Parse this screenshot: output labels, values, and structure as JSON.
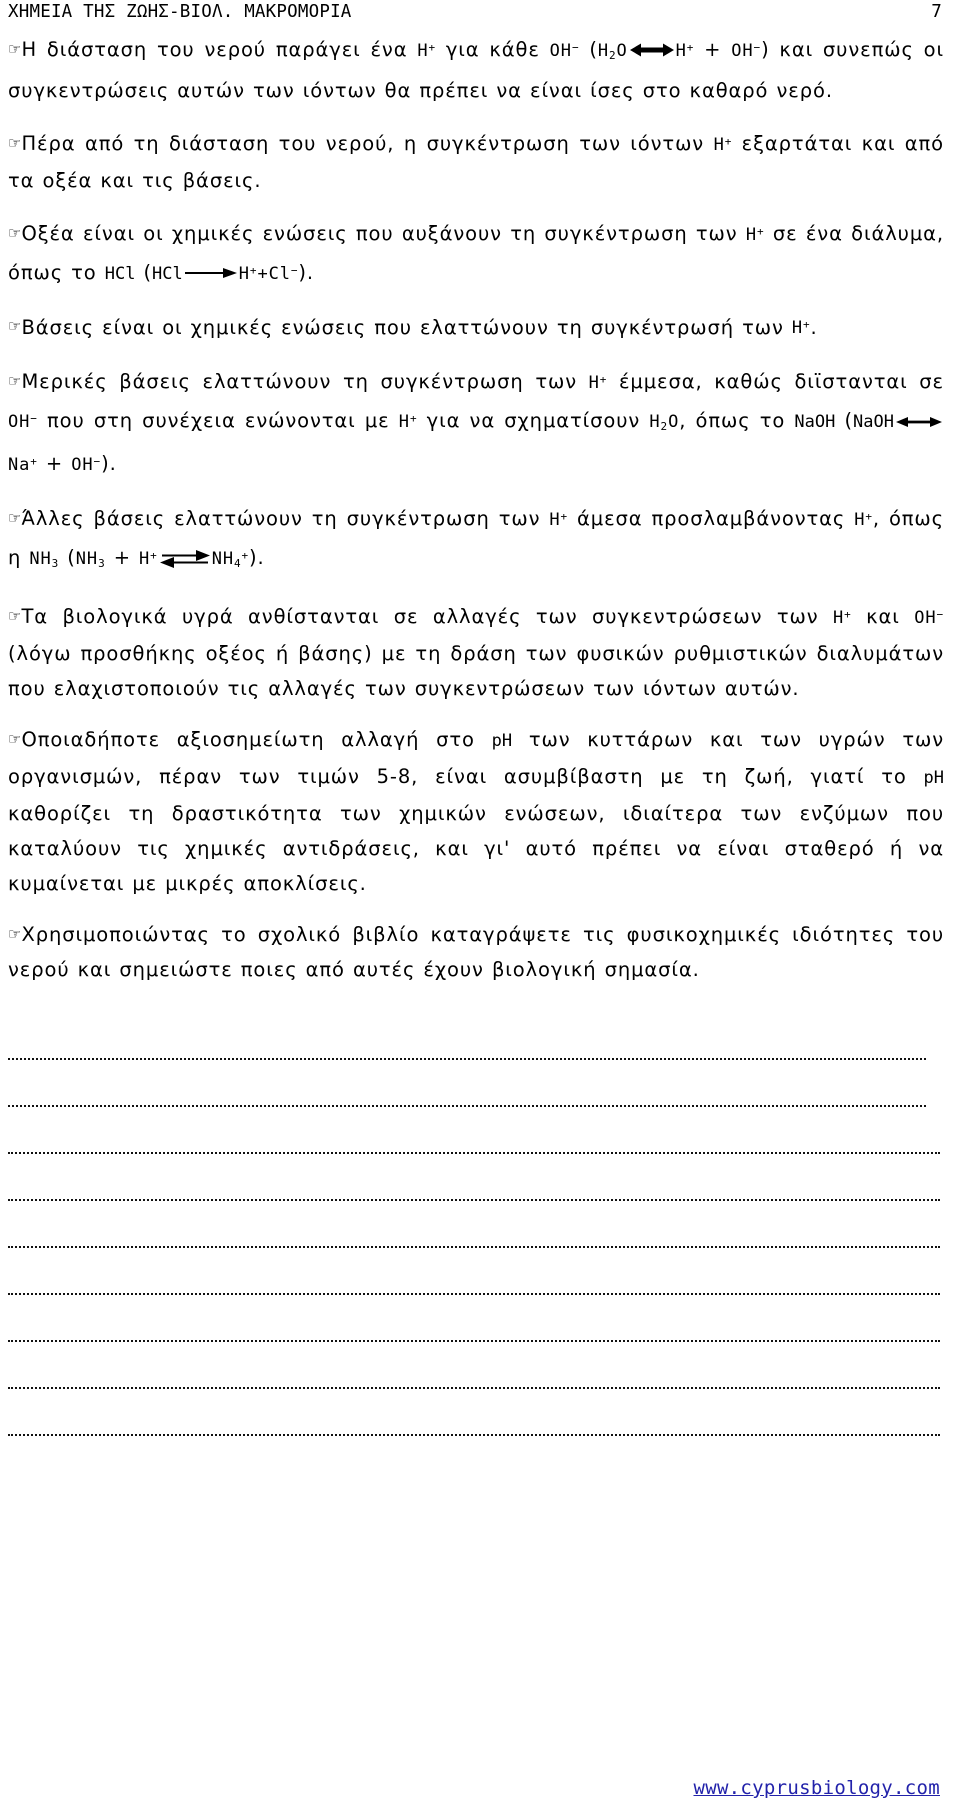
{
  "header": {
    "title": "ΧΗΜΕΙΑ ΤΗΣ ΖΩΗΣ-ΒΙΟΛ. ΜΑΚΡΟΜΟΡΙΑ",
    "page_number": "7"
  },
  "bullet_glyph": "☞",
  "paragraphs": [
    {
      "id": "p1-water-dissociation",
      "bullet": "☞",
      "parts": [
        {
          "type": "text",
          "value": "Η διάσταση του νερού παράγει ένα "
        },
        {
          "type": "chem",
          "value": "H+"
        },
        {
          "type": "text",
          "value": " για κάθε "
        },
        {
          "type": "chem",
          "value": "OH−"
        },
        {
          "type": "text",
          "value": " ("
        },
        {
          "type": "chem",
          "value": "H2O"
        },
        {
          "type": "arrow",
          "value": "double-head-bold"
        },
        {
          "type": "chem",
          "value": "H+"
        },
        {
          "type": "text",
          "value": " + "
        },
        {
          "type": "chem",
          "value": "OH−"
        },
        {
          "type": "text",
          "value": ") και συνεπώς οι συγκεντρώσεις αυτών των ιόντων θα πρέπει να είναι ίσες στο καθαρό νερό."
        }
      ],
      "plain_text": "Η διάσταση του νερού παράγει ένα H+ για κάθε OH− (H2O ⟺ H+ + OH−) και συνεπώς οι συγκεντρώσεις αυτών των ιόντων θα πρέπει να είναι ίσες στο καθαρό νερό."
    },
    {
      "id": "p2-beyond-dissociation",
      "bullet": "☞",
      "plain_text": "Πέρα από τη διάσταση του νερού, η συγκέντρωση των ιόντων H+ εξαρτάται και από τα οξέα και τις βάσεις."
    },
    {
      "id": "p3-acids",
      "bullet": "☞",
      "plain_text": "Οξέα είναι οι χημικές ενώσεις που αυξάνουν τη συγκέντρωση των H+ σε ένα διάλυμα, όπως το HCl (HCl ⟶ H++Cl−)."
    },
    {
      "id": "p4-bases",
      "bullet": "☞",
      "plain_text": "Βάσεις είναι οι χημικές ενώσεις που ελαττώνουν τη συγκέντρωσή των H+."
    },
    {
      "id": "p5-some-bases",
      "bullet": "☞",
      "plain_text": "Μερικές βάσεις ελαττώνουν τη συγκέντρωση των H+ έμμεσα, καθώς διϊστανται σε OH− που στη συνέχεια ενώνονται με H+ για να σχηματίσουν H2O, όπως το NaOH (NaOH ↔ Na+ + OH−)."
    },
    {
      "id": "p6-other-bases",
      "bullet": "☞",
      "plain_text": "Άλλες βάσεις ελαττώνουν τη συγκέντρωση των H+ άμεσα προσλαμβάνοντας H+, όπως η NH3 (NH3 + H+ ⇌ NH4+)."
    },
    {
      "id": "p7-biological-fluids",
      "bullet": "☞",
      "plain_text": "Τα βιολογικά υγρά ανθίστανται σε αλλαγές των συγκεντρώσεων των H+ και OH− (λόγω προσθήκης οξέος ή βάσης) με τη δράση των φυσικών ρυθμιστικών διαλυμάτων που ελαχιστοποιούν τις αλλαγές των συγκεντρώσεων των ιόντων αυτών."
    },
    {
      "id": "p8-ph-range",
      "bullet": "☞",
      "plain_text": "Οποιαδήποτε αξιοσημείωτη αλλαγή στο pH των κυττάρων και των υγρών των οργανισμών, πέραν των τιμών 5-8, είναι ασυμβίβαστη με τη ζωή, γιατί το pH καθορίζει τη δραστικότητα των χημικών ενώσεων, ιδιαίτερα των ενζύμων που καταλύουν τις χημικές αντιδράσεις, και γι' αυτό πρέπει να είναι σταθερό ή να κυμαίνεται με μικρές αποκλίσεις."
    },
    {
      "id": "p9-task",
      "bullet": "☞",
      "plain_text": "Χρησιμοποιώντας το σχολικό βιβλίο καταγράψετε τις φυσικοχημικές ιδιότητες του νερού και σημειώστε ποιες από αυτές έχουν βιολογική σημασία."
    }
  ],
  "paragraph_lines": {
    "p1": [
      "Η διάσταση του νερού παράγει ένα H+ για κάθε OH− (H2O ⟺ H+ +",
      "OH−) και συνεπώς οι συγκεντρώσεις αυτών των ιόντων θα πρέπει να",
      "είναι ίσες στο καθαρό νερό."
    ],
    "p2": [
      "Πέρα από τη διάσταση του νερού, η συγκέντρωση των ιόντων H+",
      "εξαρτάται και από τα οξέα και τις βάσεις."
    ],
    "p3": [
      "Οξέα είναι οι χημικές ενώσεις που αυξάνουν τη συγκέντρωση των",
      "H+ σε ένα διάλυμα, όπως το HCl (HCl ⟶ H++Cl−)."
    ],
    "p4": [
      "Βάσεις είναι οι χημικές ενώσεις που ελαττώνουν τη συγκέντρωσή",
      "των H+."
    ],
    "p5": [
      "Μερικές βάσεις ελαττώνουν τη συγκέντρωση των H+ έμμεσα, καθώς",
      "διϊστανται σε OH− που στη συνέχεια ενώνονται με H+ για να",
      "σχηματίσουν H2O, όπως το NaOH (NaOH ↔ Na+ + OH−)."
    ],
    "p6": [
      "Άλλες βάσεις ελαττώνουν τη συγκέντρωση των H+ άμεσα",
      "προσλαμβάνοντας H+, όπως η NH3 (NH3 + H+ ⇌ NH4+)."
    ],
    "p7": [
      "Τα βιολογικά υγρά ανθίστανται σε αλλαγές των συγκεντρώσεων",
      "των H+ και OH− (λόγω προσθήκης οξέος ή βάσης) με τη δράση των",
      "φυσικών ρυθμιστικών διαλυμάτων που ελαχιστοποιούν τις αλλαγές",
      "των συγκεντρώσεων των ιόντων αυτών."
    ],
    "p8": [
      "Οποιαδήποτε αξιοσημείωτη αλλαγή στο pH των κυττάρων και των",
      "υγρών των οργανισμών, πέραν των τιμών 5-8, είναι ασυμβίβαστη",
      "με τη ζωή, γιατί το pH καθορίζει τη δραστικότητα των χημικών",
      "ενώσεων, ιδιαίτερα των ενζύμων που καταλύουν τις χημικές",
      "αντιδράσεις, και γι' αυτό πρέπει να είναι σταθερό ή να",
      "κυμαίνεται με μικρές αποκλίσεις."
    ],
    "p9": [
      "Χρησιμοποιώντας το σχολικό βιβλίο καταγράψετε τις",
      "φυσικοχημικές ιδιότητες του νερού και σημειώστε ποιες από",
      "αυτές έχουν βιολογική σημασία."
    ]
  },
  "text_fragments": {
    "p1_a": "Η διάσταση του νερού παράγει ένα ",
    "p1_b": " για κάθε ",
    "p1_c": " (",
    "p1_d": ") και συνεπώς οι συγκεντρώσεις αυτών των ιόντων θα πρέπει να είναι ίσες στο καθαρό νερό.",
    "p1_plus": " + ",
    "p2_a": "Πέρα από τη διάσταση του νερού, η συγκέντρωση των ιόντων ",
    "p2_b": " εξαρτάται και από τα οξέα και τις βάσεις.",
    "p3_a": "Οξέα είναι οι χημικές ενώσεις που αυξάνουν τη συγκέντρωση των ",
    "p3_b": " σε ένα διάλυμα, όπως το ",
    "p3_c": " (",
    "p3_d": ").",
    "p4_a": "Βάσεις είναι οι χημικές ενώσεις που ελαττώνουν τη συγκέντρωσή των ",
    "p4_b": ".",
    "p5_a": "Μερικές βάσεις ελαττώνουν τη συγκέντρωση των ",
    "p5_b": " έμμεσα, καθώς διϊστανται σε ",
    "p5_c": " που στη συνέχεια ενώνονται με ",
    "p5_d": " για να σχηματίσουν ",
    "p5_e": ", όπως το ",
    "p5_f": " (",
    "p5_g": ").",
    "p5_plus": " + ",
    "p6_a": "Άλλες βάσεις ελαττώνουν τη συγκέντρωση των ",
    "p6_b": " άμεσα προσλαμβάνοντας ",
    "p6_c": ", όπως η ",
    "p6_d": " (",
    "p6_plus": " + ",
    "p6_e": ").",
    "p7_a": "Τα βιολογικά υγρά ανθίστανται σε αλλαγές των συγκεντρώσεων των ",
    "p7_b": " και ",
    "p7_c": " (λόγω προσθήκης οξέος ή βάσης) με τη δράση των φυσικών ρυθμιστικών διαλυμάτων που ελαχιστοποιούν τις αλλαγές των συγκεντρώσεων των ιόντων αυτών.",
    "p8_a": "Οποιαδήποτε αξιοσημείωτη αλλαγή στο ",
    "p8_b": " των κυττάρων και των υγρών των οργανισμών, πέραν των τιμών 5-8, είναι ασυμβίβαστη με τη ζωή, γιατί το ",
    "p8_c": " καθορίζει τη δραστικότητα των χημικών ενώσεων, ιδιαίτερα των ενζύμων που καταλύουν τις χημικές αντιδράσεις, και γι' αυτό πρέπει να είναι σταθερό ή να κυμαίνεται με μικρές αποκλίσεις.",
    "p9_a": "Χρησιμοποιώντας το σχολικό βιβλίο καταγράψετε τις φυσικοχημικές ιδιότητες του νερού και σημειώστε ποιες από αυτές έχουν βιολογική σημασία."
  },
  "formulas": {
    "H_plus": "H+",
    "OH_minus": "OH−",
    "H2O": "H2O",
    "HCl": "HCl",
    "HCl_products": "H++Cl−",
    "NaOH": "NaOH",
    "Na_plus": "Na+",
    "NH3": "NH3",
    "NH4_plus": "NH4+",
    "pH": "pH",
    "ph_range": "5-8"
  },
  "answer_lines": {
    "count": 9,
    "style": "dotted"
  },
  "footer": {
    "url": "www.cyprusbiology.com",
    "color": "#2222aa"
  },
  "colors": {
    "page_background": "#ffffff",
    "text": "#000000",
    "link": "#2222aa",
    "rule": "#111111"
  }
}
